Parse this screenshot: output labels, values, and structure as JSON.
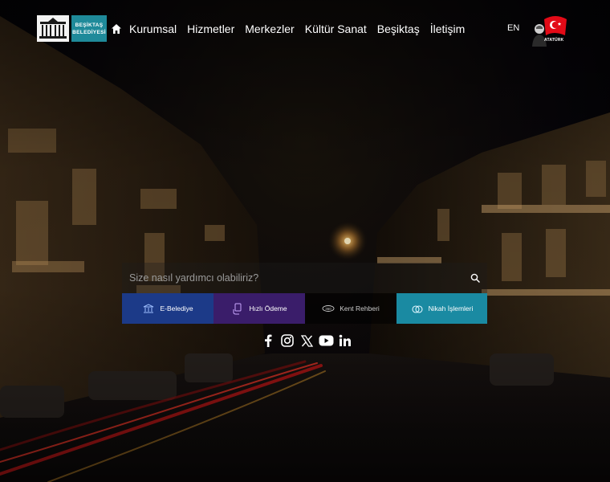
{
  "header": {
    "logo": {
      "line1": "BEŞİKTAŞ",
      "line2": "BELEDİYESİ"
    },
    "nav": [
      {
        "label": "Kurumsal"
      },
      {
        "label": "Hizmetler"
      },
      {
        "label": "Merkezler"
      },
      {
        "label": "Kültür Sanat"
      },
      {
        "label": "Beşiktaş"
      },
      {
        "label": "İletişim"
      }
    ],
    "lang": "EN",
    "ataturk": "ATATÜRK"
  },
  "search": {
    "placeholder": "Size nasıl yardımcı olabiliriz?"
  },
  "quick_links": [
    {
      "label": "E-Belediye",
      "icon": "city-hall-icon",
      "color": "#1c3a88"
    },
    {
      "label": "Hızlı Ödeme",
      "icon": "hand-payment-icon",
      "color": "#3a1d6a"
    },
    {
      "label": "Kent Rehberi",
      "icon": "map-360-icon",
      "color": "#000000"
    },
    {
      "label": "Nikah İşlemleri",
      "icon": "rings-icon",
      "color": "#1a8aa2"
    }
  ],
  "social": [
    "facebook-icon",
    "instagram-icon",
    "x-icon",
    "youtube-icon",
    "linkedin-icon"
  ],
  "colors": {
    "brand_teal": "#1f8a9a"
  }
}
